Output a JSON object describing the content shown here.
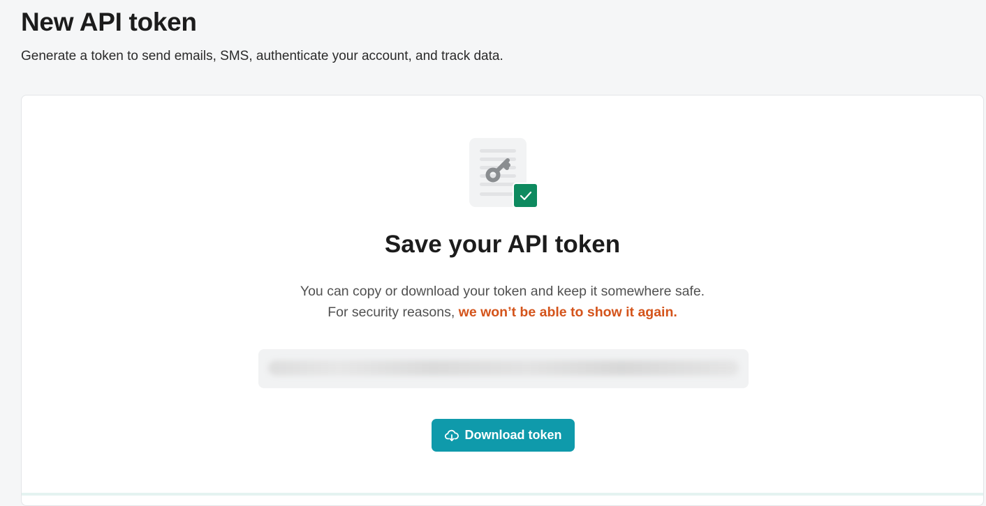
{
  "header": {
    "title": "New API token",
    "subtitle": "Generate a token to send emails, SMS, authenticate your account, and track data."
  },
  "card": {
    "title": "Save your API token",
    "line1": "You can copy or download your token and keep it somewhere safe.",
    "line2_prefix": "For security reasons, ",
    "line2_warning": "we won’t be able to show it again.",
    "token_value_hidden": true,
    "illustration_icons": [
      "document-key-icon",
      "check-badge-icon"
    ],
    "download_button": {
      "label": "Download token",
      "icon": "cloud-download-icon"
    }
  },
  "colors": {
    "page_bg": "#f5f6f7",
    "card_bg": "#ffffff",
    "accent_button": "#0f9aab",
    "warning_text": "#d4541b",
    "check_badge": "#0e8a5f"
  }
}
